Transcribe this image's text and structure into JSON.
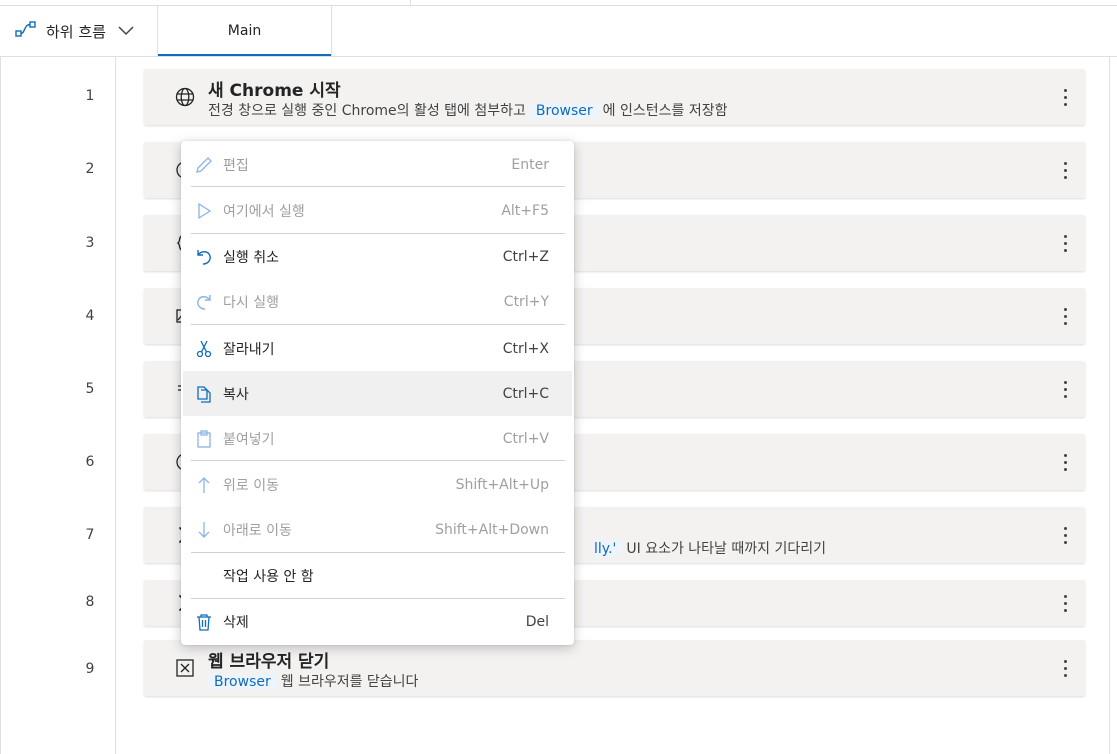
{
  "header": {
    "subflows_label": "하위 흐름",
    "main_tab_label": "Main"
  },
  "colors": {
    "accent": "#0f6cbd",
    "chip_bg": "#edf4fc",
    "step_bg": "#f3f2f1"
  },
  "steps": [
    {
      "num": "1",
      "icon": "globe-icon",
      "title": "새 Chrome 시작",
      "desc_before": "전경 창으로 실행 중인 Chrome의 활성 탭에 첨부하고",
      "chip": "Browser",
      "desc_after": "에 인스턴스를 저장함"
    },
    {
      "num": "2",
      "icon": "clock-icon"
    },
    {
      "num": "3",
      "icon": "variable-icon"
    },
    {
      "num": "4",
      "icon": "image-icon"
    },
    {
      "num": "5",
      "icon": "text-icon"
    },
    {
      "num": "6",
      "icon": "clock-icon"
    },
    {
      "num": "7",
      "icon": "hourglass-icon",
      "desc_late_chip": "lly.'",
      "desc_late": "UI 요소가 나타날 때까지 기다리기"
    },
    {
      "num": "8",
      "icon": "hourglass-icon"
    },
    {
      "num": "9",
      "icon": "close-box-icon",
      "title": "웹 브라우저 닫기",
      "chip": "Browser",
      "desc_after": "웹 브라우저를 닫습니다"
    }
  ],
  "context_menu": {
    "items": [
      {
        "label": "편집",
        "shortcut": "Enter",
        "icon": "pencil-icon",
        "enabled": false
      },
      {
        "label": "여기에서 실행",
        "shortcut": "Alt+F5",
        "icon": "play-icon",
        "enabled": false
      },
      {
        "label": "실행 취소",
        "shortcut": "Ctrl+Z",
        "icon": "undo-icon",
        "enabled": true
      },
      {
        "label": "다시 실행",
        "shortcut": "Ctrl+Y",
        "icon": "redo-icon",
        "enabled": false
      },
      {
        "label": "잘라내기",
        "shortcut": "Ctrl+X",
        "icon": "scissors-icon",
        "enabled": true
      },
      {
        "label": "복사",
        "shortcut": "Ctrl+C",
        "icon": "copy-icon",
        "enabled": true,
        "hovered": true
      },
      {
        "label": "붙여넣기",
        "shortcut": "Ctrl+V",
        "icon": "paste-icon",
        "enabled": false
      },
      {
        "label": "위로 이동",
        "shortcut": "Shift+Alt+Up",
        "icon": "arrow-up-icon",
        "enabled": false
      },
      {
        "label": "아래로 이동",
        "shortcut": "Shift+Alt+Down",
        "icon": "arrow-down-icon",
        "enabled": false
      },
      {
        "label": "작업 사용 안 함",
        "shortcut": "",
        "icon": "",
        "enabled": true
      },
      {
        "label": "삭제",
        "shortcut": "Del",
        "icon": "trash-icon",
        "enabled": true
      }
    ]
  }
}
